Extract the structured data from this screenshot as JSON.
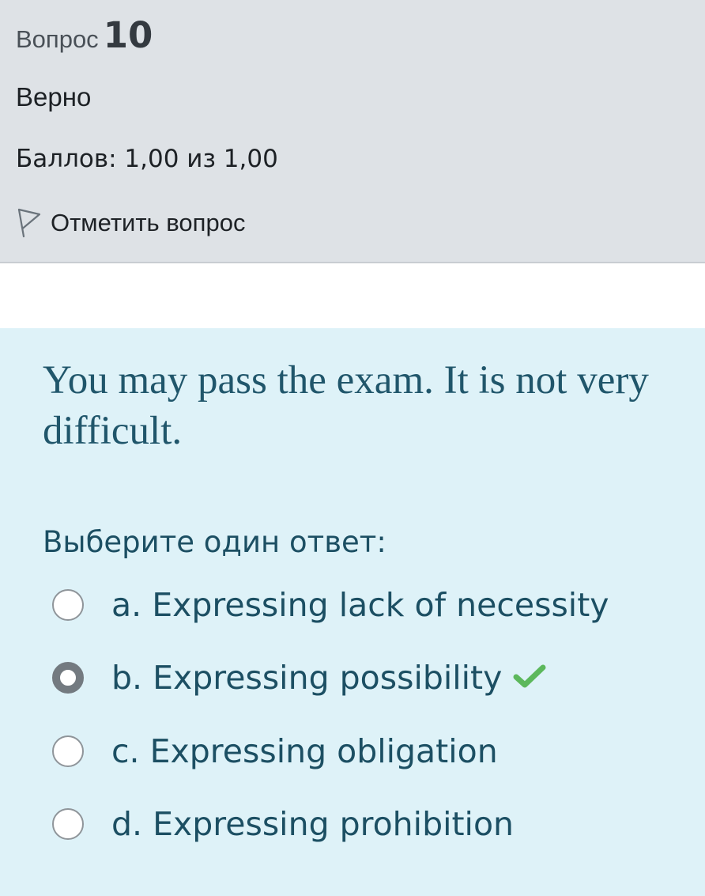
{
  "info": {
    "question_word": "Вопрос",
    "question_number": "10",
    "state": "Верно",
    "grade": "Баллов: 1,00 из 1,00",
    "flag_label": "Отметить вопрос",
    "flag_icon": "flag-outline-icon"
  },
  "question": {
    "text": "You may pass the exam. It is not very difficult.",
    "prompt": "Выберите один ответ:",
    "options": [
      {
        "label": "a. Expressing lack of necessity",
        "selected": false
      },
      {
        "label": "b. Expressing possibility",
        "selected": true,
        "correct_icon": "checkmark-icon"
      },
      {
        "label": "c. Expressing obligation",
        "selected": false
      },
      {
        "label": "d. Expressing prohibition",
        "selected": false
      }
    ]
  },
  "colors": {
    "info_background": "#dee2e6",
    "content_background": "#def2f8",
    "question_text": "#20566b",
    "correct_tick": "#5cb85c"
  }
}
